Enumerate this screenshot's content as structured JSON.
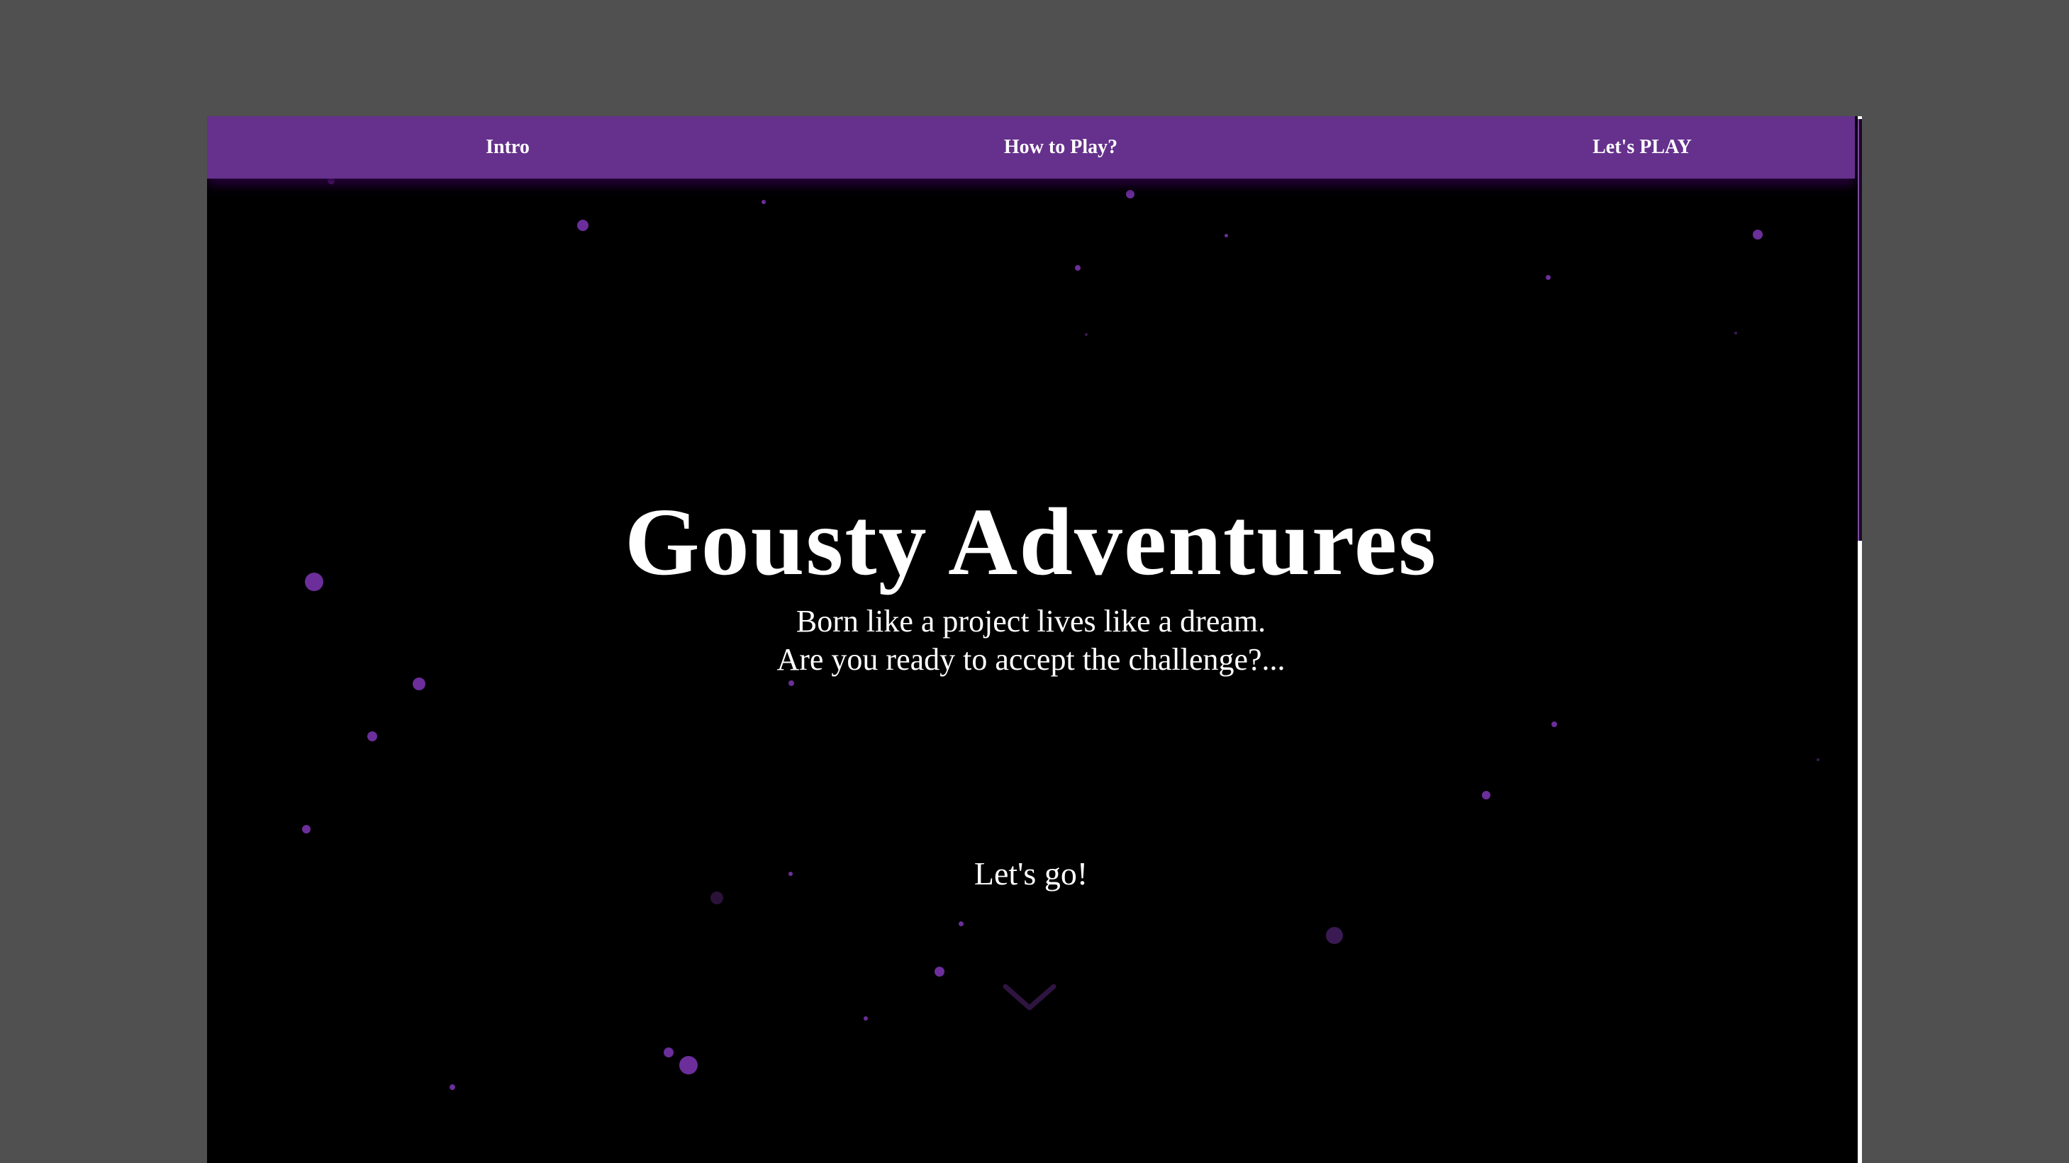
{
  "nav": {
    "items": [
      {
        "label": "Intro"
      },
      {
        "label": "How to Play?"
      },
      {
        "label": "Let's PLAY"
      }
    ]
  },
  "hero": {
    "title": "Gousty Adventures",
    "subtitle_line1": "Born like a project lives like a dream.",
    "subtitle_line2": "Are you ready to accept the challenge?...",
    "cta_label": "Let's go!",
    "scroll_icon": "chevron-down-icon"
  },
  "colors": {
    "window_bg": "#505050",
    "page_bg": "#000000",
    "nav_bg": "#65318c",
    "particle": "#6b2e9a",
    "text": "#ffffff"
  }
}
